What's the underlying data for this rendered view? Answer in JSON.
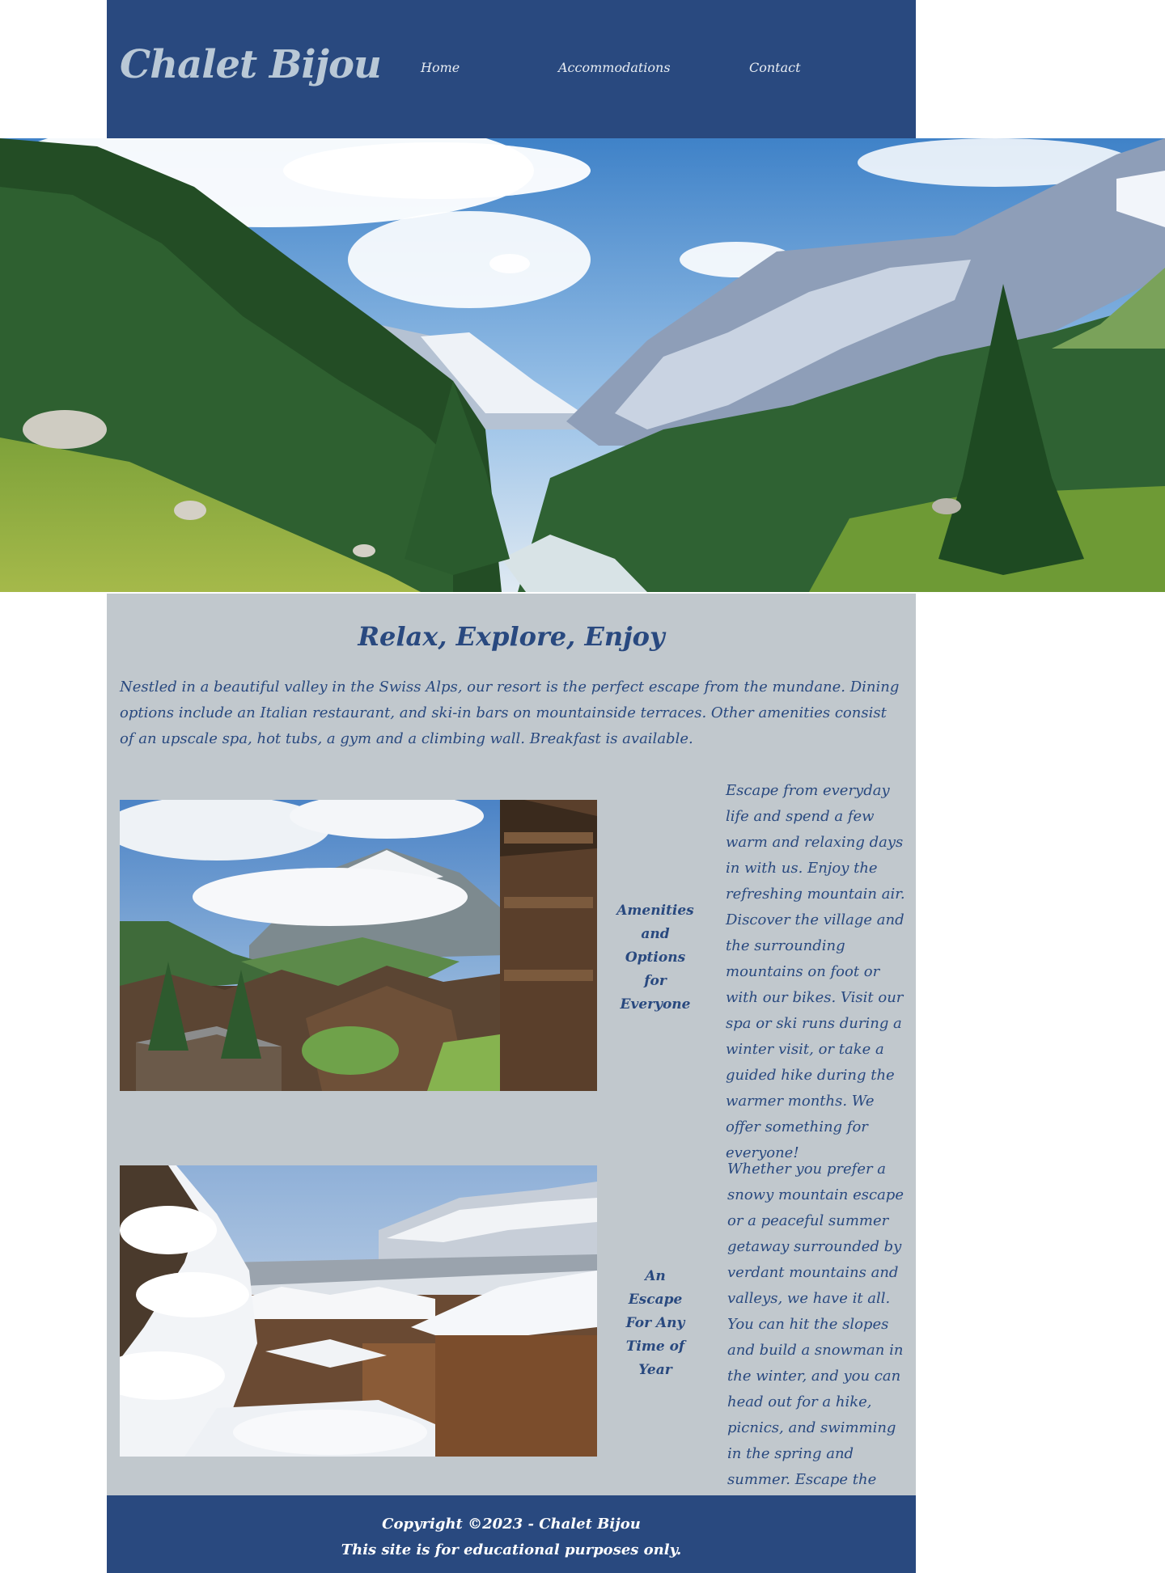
{
  "header": {
    "brand": "Chalet Bijou",
    "nav": [
      {
        "label": "Home"
      },
      {
        "label": "Accommodations"
      },
      {
        "label": "Contact"
      }
    ]
  },
  "main": {
    "heading": "Relax, Explore, Enjoy",
    "intro": "Nestled in a beautiful valley in the Swiss Alps, our resort is the perfect escape from the mundane. Dining options include an Italian restaurant, and ski-in bars on mountainside terraces. Other amenities consist of an upscale spa, hot tubs, a gym and a climbing wall. Breakfast is available.",
    "sections": [
      {
        "caption": "Amenities and Options for Everyone",
        "text": "Escape from everyday life and spend a few warm and relaxing days in with us. Enjoy the refreshing mountain air. Discover the village and the surrounding mountains on foot or with our bikes. Visit our spa or ski runs during a winter visit, or take a guided hike during the warmer months. We offer something for everyone!"
      },
      {
        "caption": "An Escape For Any Time of Year",
        "text": "Whether you prefer a snowy mountain escape or a peaceful summer getaway surrounded by verdant mountains and valleys, we have it all. You can hit the slopes and build a snowman in the winter, and you can head out for a hike, picnics, and swimming in the spring and summer. Escape the ordinary with us!"
      }
    ]
  },
  "footer": {
    "line1": "Copyright ©2023 - Chalet Bijou",
    "line2": "This site is for educational purposes only."
  },
  "colors": {
    "header_bg": "#29497f",
    "brand_text": "#b9c8d6",
    "content_bg": "#c1c8cd",
    "content_text": "#29497f"
  }
}
